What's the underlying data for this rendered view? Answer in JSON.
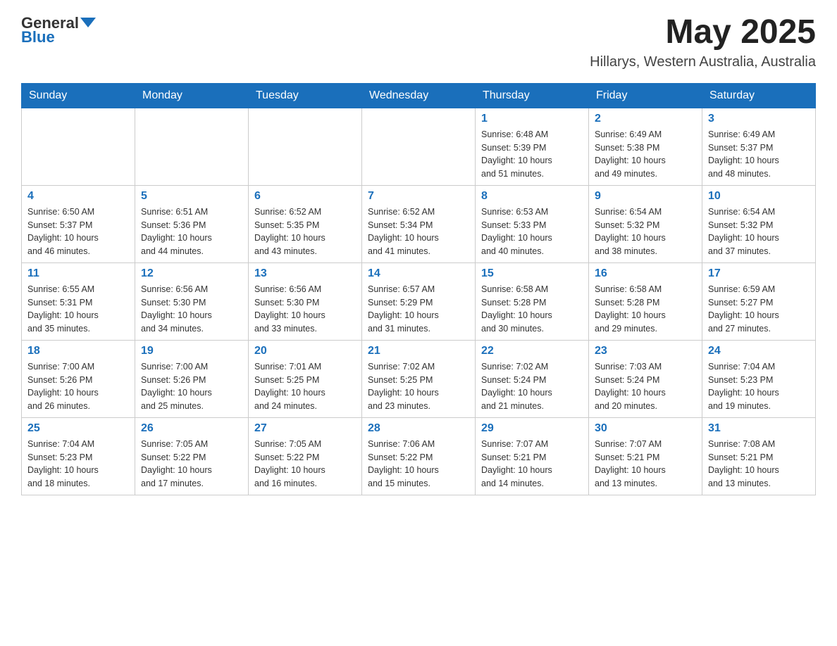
{
  "header": {
    "logo_text": "General",
    "logo_blue": "Blue",
    "month_year": "May 2025",
    "location": "Hillarys, Western Australia, Australia"
  },
  "days_of_week": [
    "Sunday",
    "Monday",
    "Tuesday",
    "Wednesday",
    "Thursday",
    "Friday",
    "Saturday"
  ],
  "weeks": [
    [
      {
        "day": "",
        "info": ""
      },
      {
        "day": "",
        "info": ""
      },
      {
        "day": "",
        "info": ""
      },
      {
        "day": "",
        "info": ""
      },
      {
        "day": "1",
        "info": "Sunrise: 6:48 AM\nSunset: 5:39 PM\nDaylight: 10 hours\nand 51 minutes."
      },
      {
        "day": "2",
        "info": "Sunrise: 6:49 AM\nSunset: 5:38 PM\nDaylight: 10 hours\nand 49 minutes."
      },
      {
        "day": "3",
        "info": "Sunrise: 6:49 AM\nSunset: 5:37 PM\nDaylight: 10 hours\nand 48 minutes."
      }
    ],
    [
      {
        "day": "4",
        "info": "Sunrise: 6:50 AM\nSunset: 5:37 PM\nDaylight: 10 hours\nand 46 minutes."
      },
      {
        "day": "5",
        "info": "Sunrise: 6:51 AM\nSunset: 5:36 PM\nDaylight: 10 hours\nand 44 minutes."
      },
      {
        "day": "6",
        "info": "Sunrise: 6:52 AM\nSunset: 5:35 PM\nDaylight: 10 hours\nand 43 minutes."
      },
      {
        "day": "7",
        "info": "Sunrise: 6:52 AM\nSunset: 5:34 PM\nDaylight: 10 hours\nand 41 minutes."
      },
      {
        "day": "8",
        "info": "Sunrise: 6:53 AM\nSunset: 5:33 PM\nDaylight: 10 hours\nand 40 minutes."
      },
      {
        "day": "9",
        "info": "Sunrise: 6:54 AM\nSunset: 5:32 PM\nDaylight: 10 hours\nand 38 minutes."
      },
      {
        "day": "10",
        "info": "Sunrise: 6:54 AM\nSunset: 5:32 PM\nDaylight: 10 hours\nand 37 minutes."
      }
    ],
    [
      {
        "day": "11",
        "info": "Sunrise: 6:55 AM\nSunset: 5:31 PM\nDaylight: 10 hours\nand 35 minutes."
      },
      {
        "day": "12",
        "info": "Sunrise: 6:56 AM\nSunset: 5:30 PM\nDaylight: 10 hours\nand 34 minutes."
      },
      {
        "day": "13",
        "info": "Sunrise: 6:56 AM\nSunset: 5:30 PM\nDaylight: 10 hours\nand 33 minutes."
      },
      {
        "day": "14",
        "info": "Sunrise: 6:57 AM\nSunset: 5:29 PM\nDaylight: 10 hours\nand 31 minutes."
      },
      {
        "day": "15",
        "info": "Sunrise: 6:58 AM\nSunset: 5:28 PM\nDaylight: 10 hours\nand 30 minutes."
      },
      {
        "day": "16",
        "info": "Sunrise: 6:58 AM\nSunset: 5:28 PM\nDaylight: 10 hours\nand 29 minutes."
      },
      {
        "day": "17",
        "info": "Sunrise: 6:59 AM\nSunset: 5:27 PM\nDaylight: 10 hours\nand 27 minutes."
      }
    ],
    [
      {
        "day": "18",
        "info": "Sunrise: 7:00 AM\nSunset: 5:26 PM\nDaylight: 10 hours\nand 26 minutes."
      },
      {
        "day": "19",
        "info": "Sunrise: 7:00 AM\nSunset: 5:26 PM\nDaylight: 10 hours\nand 25 minutes."
      },
      {
        "day": "20",
        "info": "Sunrise: 7:01 AM\nSunset: 5:25 PM\nDaylight: 10 hours\nand 24 minutes."
      },
      {
        "day": "21",
        "info": "Sunrise: 7:02 AM\nSunset: 5:25 PM\nDaylight: 10 hours\nand 23 minutes."
      },
      {
        "day": "22",
        "info": "Sunrise: 7:02 AM\nSunset: 5:24 PM\nDaylight: 10 hours\nand 21 minutes."
      },
      {
        "day": "23",
        "info": "Sunrise: 7:03 AM\nSunset: 5:24 PM\nDaylight: 10 hours\nand 20 minutes."
      },
      {
        "day": "24",
        "info": "Sunrise: 7:04 AM\nSunset: 5:23 PM\nDaylight: 10 hours\nand 19 minutes."
      }
    ],
    [
      {
        "day": "25",
        "info": "Sunrise: 7:04 AM\nSunset: 5:23 PM\nDaylight: 10 hours\nand 18 minutes."
      },
      {
        "day": "26",
        "info": "Sunrise: 7:05 AM\nSunset: 5:22 PM\nDaylight: 10 hours\nand 17 minutes."
      },
      {
        "day": "27",
        "info": "Sunrise: 7:05 AM\nSunset: 5:22 PM\nDaylight: 10 hours\nand 16 minutes."
      },
      {
        "day": "28",
        "info": "Sunrise: 7:06 AM\nSunset: 5:22 PM\nDaylight: 10 hours\nand 15 minutes."
      },
      {
        "day": "29",
        "info": "Sunrise: 7:07 AM\nSunset: 5:21 PM\nDaylight: 10 hours\nand 14 minutes."
      },
      {
        "day": "30",
        "info": "Sunrise: 7:07 AM\nSunset: 5:21 PM\nDaylight: 10 hours\nand 13 minutes."
      },
      {
        "day": "31",
        "info": "Sunrise: 7:08 AM\nSunset: 5:21 PM\nDaylight: 10 hours\nand 13 minutes."
      }
    ]
  ]
}
